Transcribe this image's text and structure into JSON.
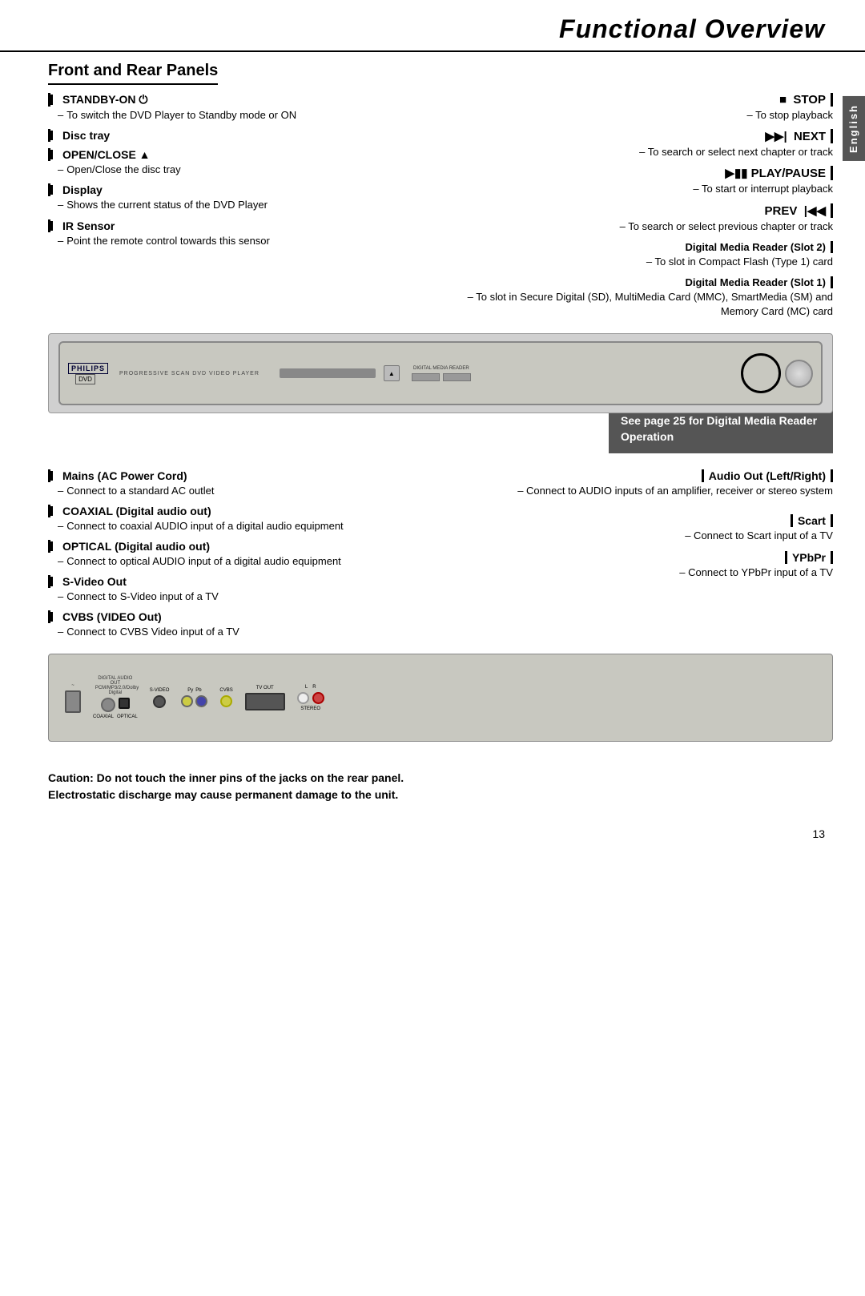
{
  "page": {
    "title": "Functional Overview",
    "sidebar_label": "English",
    "page_number": "13"
  },
  "sections": {
    "front_rear_title": "Front and Rear Panels"
  },
  "front_left_annotations": [
    {
      "id": "standby",
      "title": "STANDBY-ON ⏻",
      "desc": "To switch the DVD Player to Standby mode or ON"
    },
    {
      "id": "disc-tray",
      "title": "Disc tray",
      "desc": ""
    },
    {
      "id": "open-close",
      "title": "OPEN/CLOSE ▲",
      "desc": "Open/Close the disc tray"
    },
    {
      "id": "display",
      "title": "Display",
      "desc": "Shows the current status of the DVD Player"
    },
    {
      "id": "ir-sensor",
      "title": "IR Sensor",
      "desc": "Point the remote control towards this sensor"
    }
  ],
  "front_right_annotations": [
    {
      "id": "stop",
      "title": "■  STOP",
      "desc": "To stop playback"
    },
    {
      "id": "next",
      "title": "▶▶|  NEXT",
      "desc": "To search or select next chapter or track"
    },
    {
      "id": "play-pause",
      "title": "▶||  PLAY/PAUSE",
      "desc": "To start or interrupt playback"
    },
    {
      "id": "prev",
      "title": "PREV  |◀◀",
      "desc": "To search or select previous chapter or track"
    },
    {
      "id": "dmr-slot2",
      "title": "Digital Media Reader (Slot 2)",
      "desc": "To slot in Compact Flash (Type 1) card"
    },
    {
      "id": "dmr-slot1",
      "title": "Digital Media Reader (Slot 1)",
      "desc": "To slot in Secure Digital (SD), MultiMedia Card (MMC), SmartMedia (SM) and Memory Card (MC) card"
    }
  ],
  "callout": {
    "text": "See page 25 for Digital Media Reader Operation"
  },
  "rear_left_annotations": [
    {
      "id": "mains",
      "title": "Mains (AC Power Cord)",
      "desc": "Connect to a standard AC outlet"
    },
    {
      "id": "coaxial",
      "title": "COAXIAL (Digital audio out)",
      "desc": "Connect to coaxial AUDIO input of a digital audio equipment"
    },
    {
      "id": "optical",
      "title": "OPTICAL (Digital audio out)",
      "desc": "Connect to optical AUDIO input of a digital audio equipment"
    },
    {
      "id": "svideo",
      "title": "S-Video Out",
      "desc": "Connect to S-Video input of a TV"
    },
    {
      "id": "cvbs",
      "title": "CVBS (VIDEO Out)",
      "desc": "Connect to CVBS Video input of a TV"
    }
  ],
  "rear_right_annotations": [
    {
      "id": "audio-out",
      "title": "Audio Out (Left/Right)",
      "desc": "Connect to AUDIO inputs of an amplifier, receiver or stereo system"
    },
    {
      "id": "scart",
      "title": "Scart",
      "desc": "Connect to Scart input of a TV"
    },
    {
      "id": "ypbpr",
      "title": "YPbPr",
      "desc": "Connect to YPbPr input of a TV"
    }
  ],
  "caution": {
    "line1": "Caution: Do not touch the inner pins of the jacks on the rear panel.",
    "line2": "Electrostatic discharge may cause permanent damage to the unit."
  },
  "device_front": {
    "brand": "PHILIPS",
    "type": "DVD",
    "label": "PROGRESSIVE SCAN DVD VIDEO PLAYER"
  },
  "device_rear": {
    "labels": [
      "DIGITAL AUDIO OUT",
      "CVBS",
      "Y",
      "L",
      "R",
      "COAXIAL",
      "OPTICAL",
      "S-VIDEO",
      "Py",
      "Pb",
      "TV OUT",
      "STEREO"
    ]
  }
}
